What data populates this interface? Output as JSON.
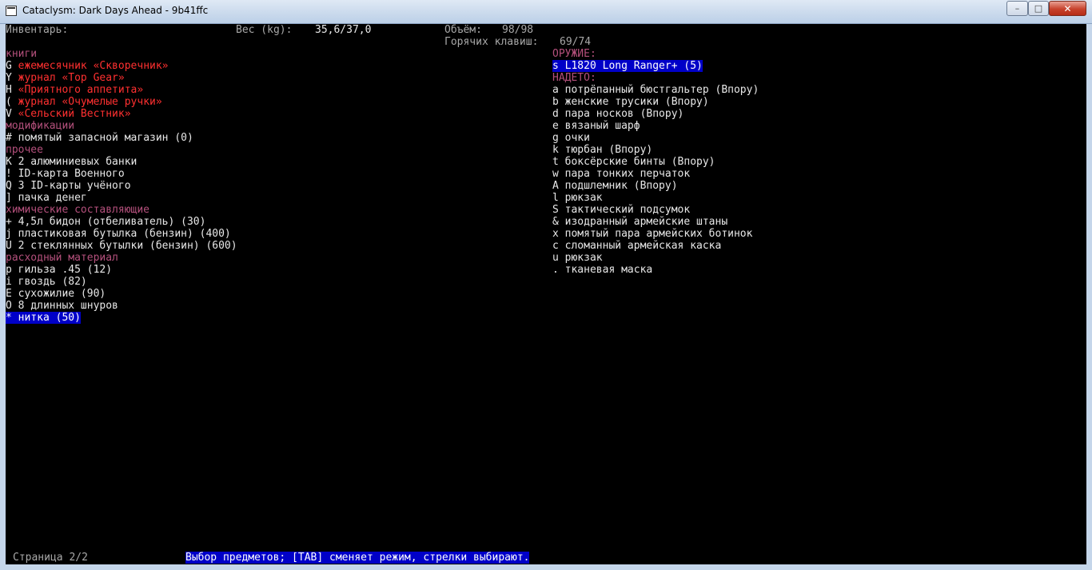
{
  "window": {
    "title": "Cataclysm: Dark Days Ahead - 9b41ffc",
    "minimize_glyph": "–",
    "maximize_glyph": "□",
    "close_glyph": "✕"
  },
  "header": {
    "inventory_label": "Инвентарь:",
    "weight_label": "Вес (kg):",
    "weight_value": "35,6/37,0",
    "volume_label": "Объём:",
    "volume_value": "98/98",
    "hotkeys_label": "Горячих клавиш:",
    "hotkeys_value": "69/74"
  },
  "left_column": [
    {
      "type": "category",
      "text": "книги"
    },
    {
      "type": "item",
      "key": "G",
      "name": "ежемесячник «Скворечник»",
      "style": "red"
    },
    {
      "type": "item",
      "key": "Y",
      "name": "журнал «Top Gear»",
      "style": "red"
    },
    {
      "type": "item",
      "key": "H",
      "name": "«Приятного аппетита»",
      "style": "red"
    },
    {
      "type": "item",
      "key": "(",
      "name": "журнал «Очумелые ручки»",
      "style": "red"
    },
    {
      "type": "item",
      "key": "V",
      "name": "«Сельский Вестник»",
      "style": "red"
    },
    {
      "type": "category",
      "text": "модификации"
    },
    {
      "type": "item",
      "key": "#",
      "name": "помятый запасной магазин (0)",
      "style": "normal"
    },
    {
      "type": "category",
      "text": "прочее"
    },
    {
      "type": "item",
      "key": "K",
      "name": "2 алюминиевых банки",
      "style": "normal"
    },
    {
      "type": "item",
      "key": "!",
      "name": "ID-карта Военного",
      "style": "normal"
    },
    {
      "type": "item",
      "key": "Q",
      "name": "3 ID-карты учёного",
      "style": "normal"
    },
    {
      "type": "item",
      "key": "]",
      "name": "пачка денег",
      "style": "normal"
    },
    {
      "type": "category",
      "text": "химические составляющие"
    },
    {
      "type": "item",
      "key": "+",
      "name": "4,5л бидон (отбеливатель) (30)",
      "style": "normal"
    },
    {
      "type": "item",
      "key": "j",
      "name": "пластиковая бутылка (бензин) (400)",
      "style": "normal"
    },
    {
      "type": "item",
      "key": "U",
      "name": "2 стеклянных бутылки (бензин) (600)",
      "style": "normal"
    },
    {
      "type": "category",
      "text": "расходный материал"
    },
    {
      "type": "item",
      "key": "p",
      "name": "гильза .45 (12)",
      "style": "normal"
    },
    {
      "type": "item",
      "key": "i",
      "name": "гвоздь (82)",
      "style": "normal"
    },
    {
      "type": "item",
      "key": "E",
      "name": "сухожилие (90)",
      "style": "normal"
    },
    {
      "type": "item",
      "key": "O",
      "name": "8 длинных шнуров",
      "style": "normal"
    },
    {
      "type": "item",
      "key": "*",
      "name": "нитка (50)",
      "style": "selected"
    }
  ],
  "right_column": [
    {
      "type": "category",
      "text": "ОРУЖИЕ:"
    },
    {
      "type": "item",
      "key": "s",
      "name": "L1820 Long Ranger+ (5)",
      "style": "selected"
    },
    {
      "type": "category",
      "text": "НАДЕТО:"
    },
    {
      "type": "item",
      "key": "a",
      "name": "потрёпанный бюстгальтер (Впору)",
      "style": "normal"
    },
    {
      "type": "item",
      "key": "b",
      "name": "женские трусики (Впору)",
      "style": "normal"
    },
    {
      "type": "item",
      "key": "d",
      "name": "пара носков (Впору)",
      "style": "normal"
    },
    {
      "type": "item",
      "key": "e",
      "name": "вязаный шарф",
      "style": "normal"
    },
    {
      "type": "item",
      "key": "g",
      "name": "очки",
      "style": "normal"
    },
    {
      "type": "item",
      "key": "k",
      "name": "тюрбан (Впору)",
      "style": "normal"
    },
    {
      "type": "item",
      "key": "t",
      "name": "боксёрские бинты (Впору)",
      "style": "normal"
    },
    {
      "type": "item",
      "key": "w",
      "name": "пара тонких перчаток",
      "style": "normal"
    },
    {
      "type": "item",
      "key": "A",
      "name": "подшлемник (Впору)",
      "style": "normal"
    },
    {
      "type": "item",
      "key": "l",
      "name": "рюкзак",
      "style": "normal"
    },
    {
      "type": "item",
      "key": "S",
      "name": "тактический подсумок",
      "style": "normal"
    },
    {
      "type": "item",
      "key": "&",
      "name": "изодранный армейские штаны",
      "style": "normal"
    },
    {
      "type": "item",
      "key": "x",
      "name": "помятый пара армейских ботинок",
      "style": "normal"
    },
    {
      "type": "item",
      "key": "c",
      "name": "сломанный армейская каска",
      "style": "normal"
    },
    {
      "type": "item",
      "key": "u",
      "name": "рюкзак",
      "style": "normal"
    },
    {
      "type": "item",
      "key": ".",
      "name": "тканевая маска",
      "style": "normal"
    }
  ],
  "footer": {
    "page": "Страница 2/2",
    "hint": "Выбор предметов; [TAB] сменяет режим, стрелки выбирают."
  }
}
